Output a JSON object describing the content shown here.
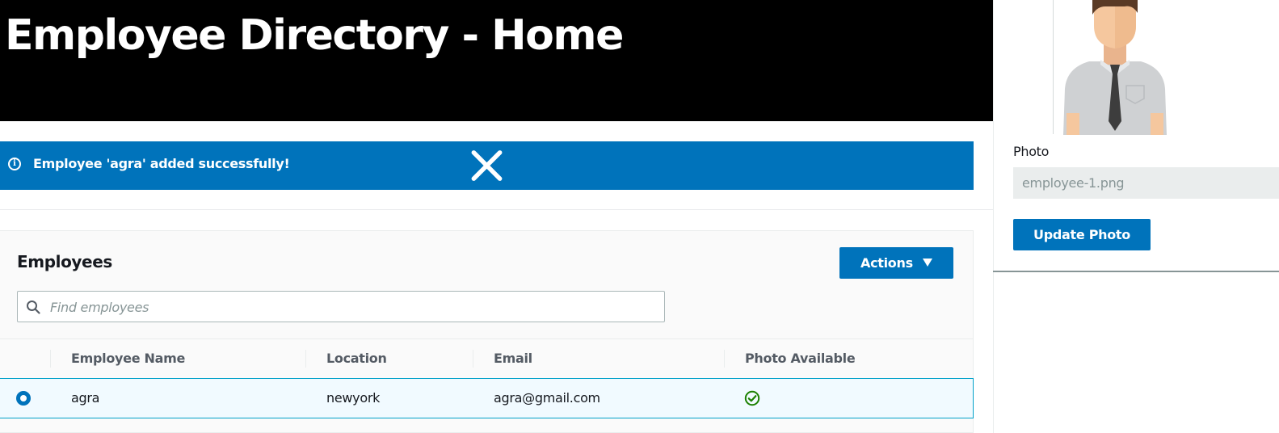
{
  "header": {
    "title": "Employee Directory - Home"
  },
  "flash": {
    "icon": "info-icon",
    "message": "Employee 'agra' added successfully!",
    "close_icon": "close-icon",
    "color": "#0073bb"
  },
  "employees": {
    "title": "Employees",
    "actions_label": "Actions",
    "actions_icon": "caret-down-icon",
    "search": {
      "icon": "search-icon",
      "placeholder": "Find employees",
      "value": ""
    },
    "columns": [
      "Employee Name",
      "Location",
      "Email",
      "Photo Available"
    ],
    "rows": [
      {
        "selected": true,
        "name": "agra",
        "location": "newyork",
        "email": "agra@gmail.com",
        "photo_available": true,
        "photo_icon": "check-circle-icon"
      }
    ]
  },
  "side_panel": {
    "avatar_icon": "employee-avatar-icon",
    "photo_label": "Photo",
    "photo_value": "employee-1.png",
    "update_label": "Update Photo"
  },
  "colors": {
    "accent": "#0073bb",
    "selected_row": "#f1faff",
    "success": "#1d8102"
  }
}
